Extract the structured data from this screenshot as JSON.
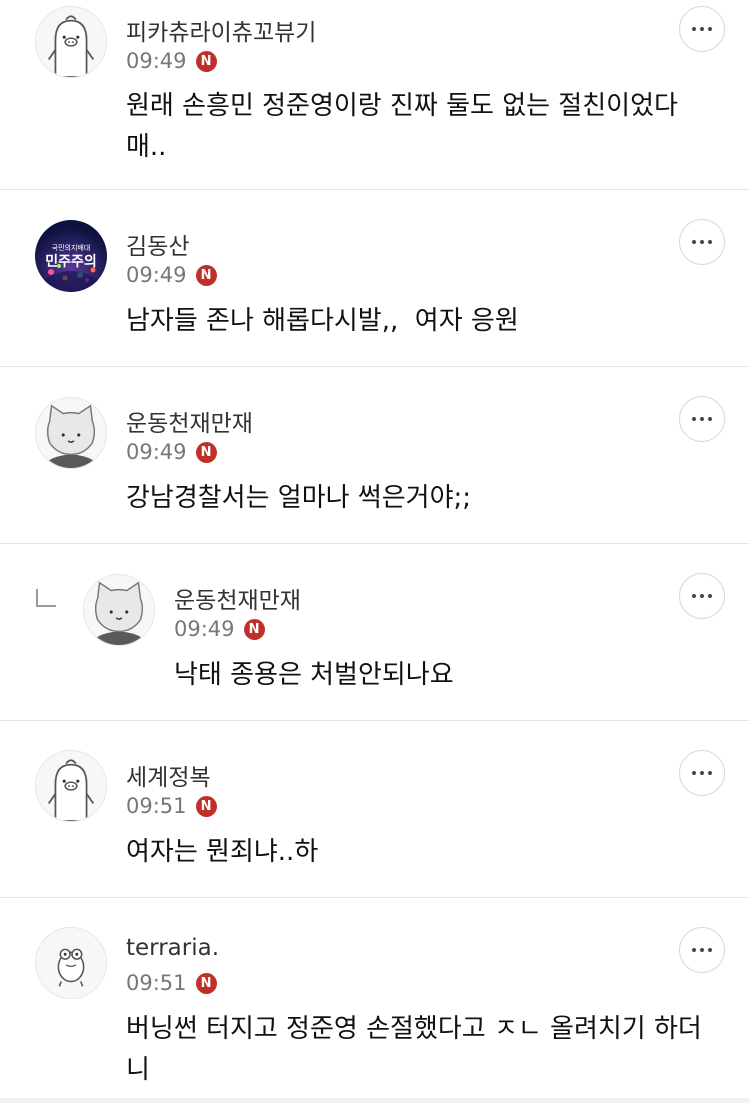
{
  "comments": [
    {
      "nickname": "피카츄라이츄꼬뷰기",
      "time": "09:49",
      "badge": "N",
      "text": "원래 손흥민 정준영이랑 진짜 둘도 없는 절친이었다매..",
      "avatar_icon": "penguin-character-icon"
    },
    {
      "nickname": "김동산",
      "time": "09:49",
      "badge": "N",
      "text": "남자들 존나 해롭다시발,,  여자 응원",
      "avatar_icon": "minjujuui-poster-icon",
      "avatar_text_small": "국민의지배대",
      "avatar_text_big": "민주주의"
    },
    {
      "nickname": "운동천재만재",
      "time": "09:49",
      "badge": "N",
      "text": "강남경찰서는 얼마나 썩은거야;;",
      "avatar_icon": "cat-character-icon"
    },
    {
      "nickname": "운동천재만재",
      "time": "09:49",
      "badge": "N",
      "text": "낙태 종용은 처벌안되나요",
      "avatar_icon": "cat-character-icon",
      "is_reply": true
    },
    {
      "nickname": "세계정복",
      "time": "09:51",
      "badge": "N",
      "text": "여자는 뭔죄냐..하",
      "avatar_icon": "penguin-character-icon"
    },
    {
      "nickname": "terraria.",
      "time": "09:51",
      "badge": "N",
      "text": "버닝썬 터지고 정준영 손절했다고 ㅈㄴ 올려치기 하더니",
      "avatar_icon": "frog-character-icon"
    }
  ],
  "colors": {
    "badge": "#c0302b",
    "divider": "#e3e3e3",
    "time": "#777777"
  }
}
